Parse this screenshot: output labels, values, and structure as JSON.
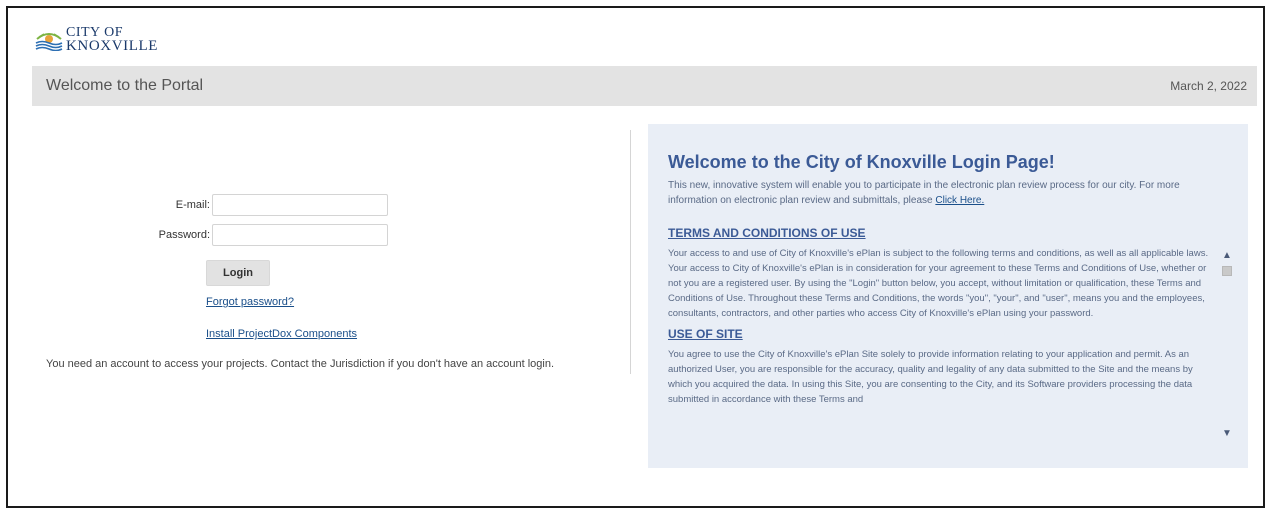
{
  "logo": {
    "line1": "CITY OF",
    "line2": "KNOXVILLE"
  },
  "header": {
    "title": "Welcome to the Portal",
    "date": "March 2, 2022"
  },
  "login": {
    "email_label": "E-mail:",
    "email_value": "",
    "password_label": "Password:",
    "password_value": "",
    "login_button": "Login",
    "forgot_link": "Forgot password?",
    "install_link": "Install ProjectDox Components",
    "notice": "You need an account to access your projects. Contact the Jurisdiction if you don't have an account login."
  },
  "welcome": {
    "heading": "Welcome to the City of Knoxville Login Page!",
    "intro_text": "This new, innovative system will enable you to participate in the electronic plan review process for our city. For more information on electronic plan review and submittals, please",
    "intro_link": "Click Here.",
    "terms_heading": "TERMS AND CONDITIONS OF USE",
    "terms_text": "Your access to and use of City of Knoxville's ePlan is subject to the following terms and conditions, as well as all applicable laws. Your access to City of Knoxville's ePlan is in consideration for your agreement to these Terms and Conditions of Use, whether or not you are a registered user. By using the \"Login\" button below, you accept, without limitation or qualification, these Terms and Conditions of Use. Throughout these Terms and Conditions, the words \"you\", \"your\", and \"user\", means you and the employees, consultants, contractors, and other parties who access City of Knoxville's ePlan using your password.",
    "use_heading": "USE OF SITE",
    "use_text": "You agree to use the City of Knoxville's ePlan Site solely to provide information relating to your application and permit.   As an authorized User, you are responsible for the accuracy, quality and legality of any data submitted to the Site and the means by which you acquired the data.  In using this Site, you are consenting to the City, and its Software providers processing the data submitted in accordance with these Terms and"
  },
  "colors": {
    "heading": "#3b5a96",
    "panel_bg": "#e9eef6",
    "titlebar_bg": "#e3e3e3",
    "link": "#1a4f8a"
  }
}
